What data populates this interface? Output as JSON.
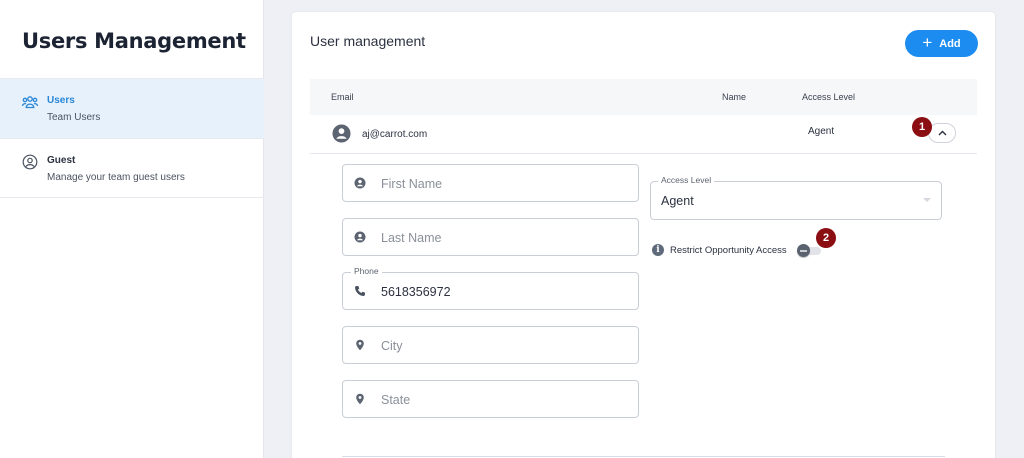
{
  "sidebar": {
    "title": "Users Management",
    "items": [
      {
        "label": "Users",
        "sub": "Team Users",
        "icon": "users-icon",
        "active": true
      },
      {
        "label": "Guest",
        "sub": "Manage your team guest users",
        "icon": "user-circle-icon",
        "active": false
      }
    ]
  },
  "main": {
    "title": "User management",
    "add_button": "Add",
    "table": {
      "columns": [
        "Email",
        "Name",
        "Access Level"
      ],
      "rows": [
        {
          "email": "aj@carrot.com",
          "name": "",
          "access_level": "Agent"
        }
      ]
    },
    "form": {
      "first_name": {
        "placeholder": "First Name",
        "icon": "user-icon"
      },
      "last_name": {
        "placeholder": "Last Name",
        "icon": "user-icon"
      },
      "phone": {
        "label": "Phone",
        "value": "5618356972",
        "icon": "phone-icon"
      },
      "city": {
        "placeholder": "City",
        "icon": "location-pin-icon"
      },
      "state": {
        "placeholder": "State",
        "icon": "location-pin-icon"
      },
      "access_level": {
        "label": "Access Level",
        "value": "Agent"
      },
      "restrict": {
        "label": "Restrict Opportunity Access",
        "enabled": false
      }
    },
    "markers": [
      "1",
      "2"
    ]
  },
  "colors": {
    "accent": "#1d8cf0",
    "active_nav_bg": "#e6f1fc",
    "active_nav_text": "#2a86d6",
    "marker": "#8a0e12"
  }
}
